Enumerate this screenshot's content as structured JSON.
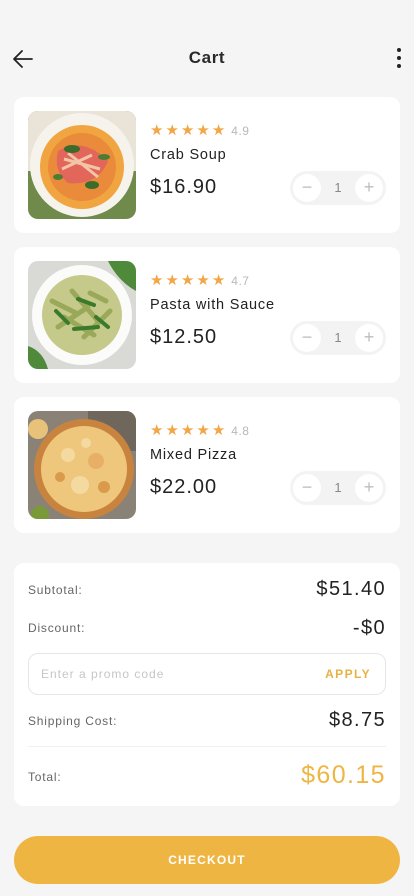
{
  "header": {
    "title": "Cart",
    "back_icon": "arrow-left-icon",
    "menu_icon": "more-vertical-icon"
  },
  "items": [
    {
      "name": "Crab Soup",
      "rating": "4.9",
      "price": "$16.90",
      "quantity": "1",
      "stars": 5,
      "image": "crab-soup-photo"
    },
    {
      "name": "Pasta with Sauce",
      "rating": "4.7",
      "price": "$12.50",
      "quantity": "1",
      "stars": 5,
      "image": "pasta-photo"
    },
    {
      "name": "Mixed Pizza",
      "rating": "4.8",
      "price": "$22.00",
      "quantity": "1",
      "stars": 5,
      "image": "pizza-photo"
    }
  ],
  "stepper": {
    "minus": "−",
    "plus": "+"
  },
  "summary": {
    "subtotal_label": "Subtotal:",
    "subtotal_value": "$51.40",
    "discount_label": "Discount:",
    "discount_value": "-$0",
    "promo_placeholder": "Enter a promo code",
    "apply_label": "APPLY",
    "shipping_label": "Shipping Cost:",
    "shipping_value": "$8.75",
    "total_label": "Total:",
    "total_value": "$60.15"
  },
  "checkout_label": "CHECKOUT",
  "colors": {
    "accent": "#efb543",
    "star": "#f2a646",
    "background": "#f5f5f5"
  }
}
